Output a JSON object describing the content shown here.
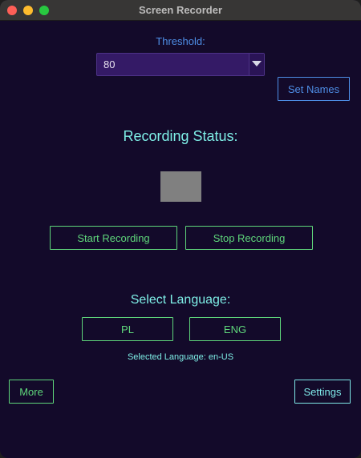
{
  "window": {
    "title": "Screen Recorder"
  },
  "threshold": {
    "label": "Threshold:",
    "selected_value": "80"
  },
  "set_names_label": "Set Names",
  "recording": {
    "heading": "Recording Status:",
    "indicator_color": "#808080",
    "start_label": "Start Recording",
    "stop_label": "Stop Recording"
  },
  "language": {
    "heading": "Select Language:",
    "options": [
      "PL",
      "ENG"
    ],
    "selected_text": "Selected Language: en-US"
  },
  "footer": {
    "more_label": "More",
    "settings_label": "Settings"
  },
  "colors": {
    "background": "#130a2a",
    "accent_blue": "#4e8ee6",
    "accent_green": "#5fd77b",
    "accent_cyan": "#7eeee6",
    "select_bg": "#341a66"
  }
}
